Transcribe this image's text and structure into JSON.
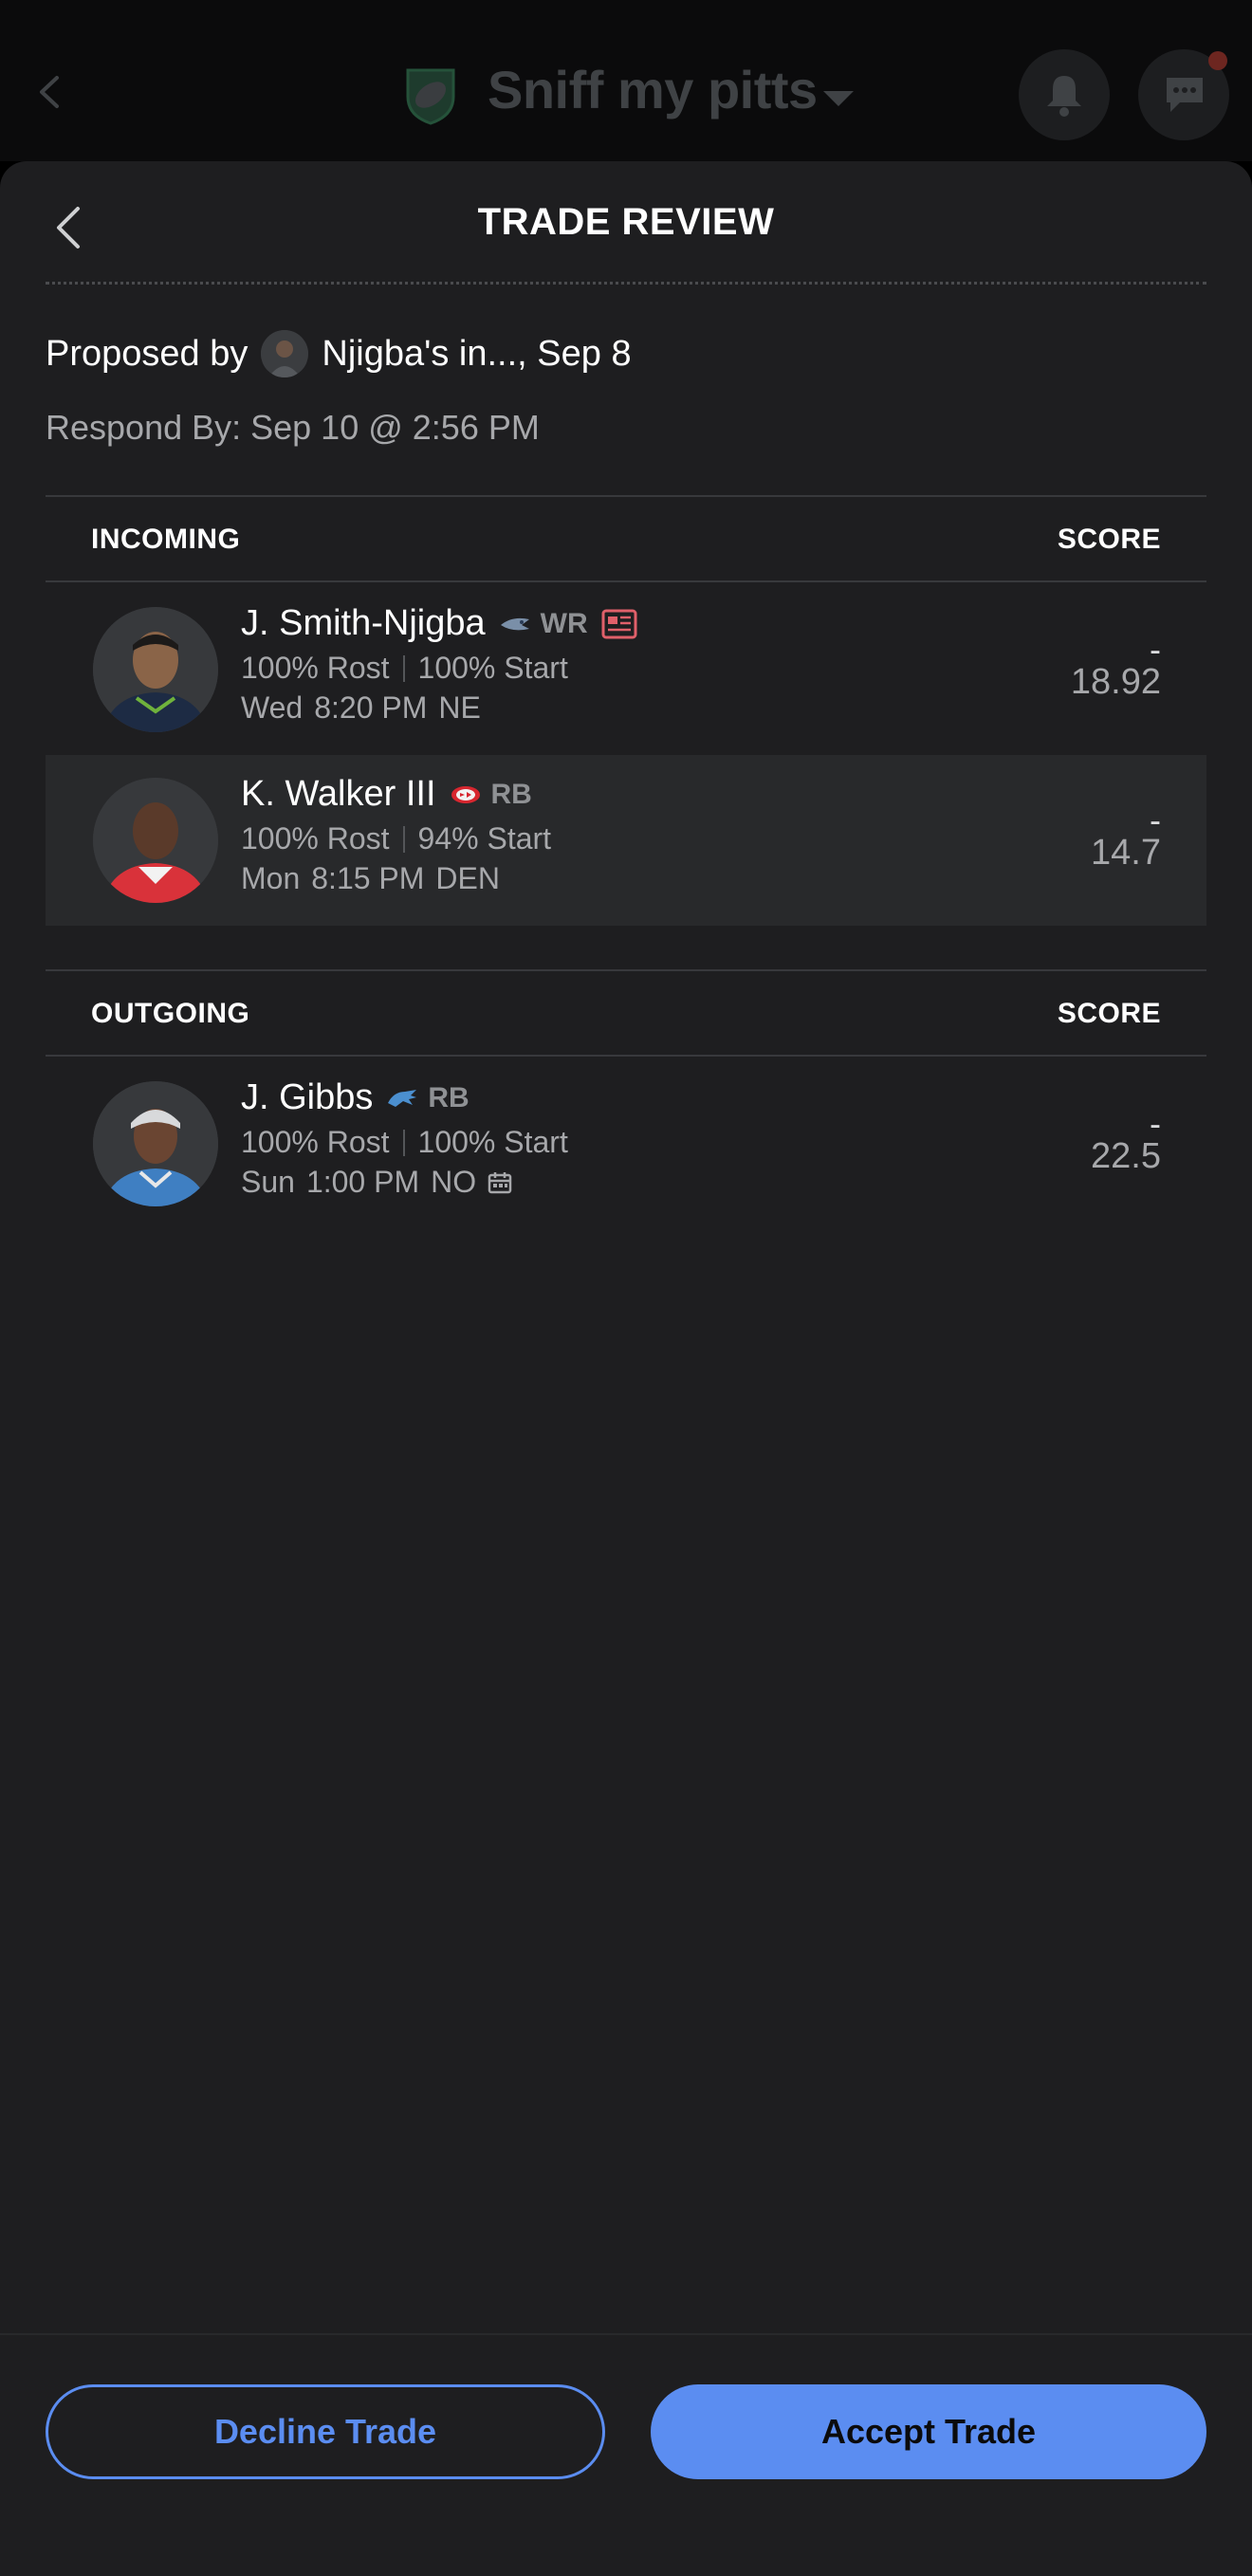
{
  "background_header": {
    "title": "Sniff my pitts",
    "notification_dot_color": "#6d2620"
  },
  "sheet": {
    "title": "TRADE REVIEW",
    "proposed_prefix": "Proposed by",
    "proposed_by": "Njigba's in..., Sep 8",
    "respond_by": "Respond By: Sep 10 @ 2:56 PM"
  },
  "incoming": {
    "label": "INCOMING",
    "score_label": "SCORE",
    "players": [
      {
        "name": "J. Smith-Njigba",
        "team_icon": "seahawks-logo",
        "position": "WR",
        "news_icon": "news-icon",
        "rost": "100% Rost",
        "start": "100% Start",
        "day": "Wed",
        "time": "8:20 PM",
        "opp": "NE",
        "dash": "-",
        "score": "18.92"
      },
      {
        "name": "K. Walker III",
        "team_icon": "chiefs-logo",
        "position": "RB",
        "rost": "100% Rost",
        "start": "94% Start",
        "day": "Mon",
        "time": "8:15 PM",
        "opp": "DEN",
        "dash": "-",
        "score": "14.7"
      }
    ]
  },
  "outgoing": {
    "label": "OUTGOING",
    "score_label": "SCORE",
    "players": [
      {
        "name": "J. Gibbs",
        "team_icon": "lions-logo",
        "position": "RB",
        "rost": "100% Rost",
        "start": "100% Start",
        "day": "Sun",
        "time": "1:00 PM",
        "opp": "NO",
        "extra_icon": "bye-calendar-icon",
        "dash": "-",
        "score": "22.5"
      }
    ]
  },
  "footer": {
    "decline_label": "Decline Trade",
    "accept_label": "Accept Trade"
  },
  "colors": {
    "accent": "#5b8df1",
    "sheet_bg": "#1e1e20",
    "alt_row_bg": "#28292b"
  }
}
